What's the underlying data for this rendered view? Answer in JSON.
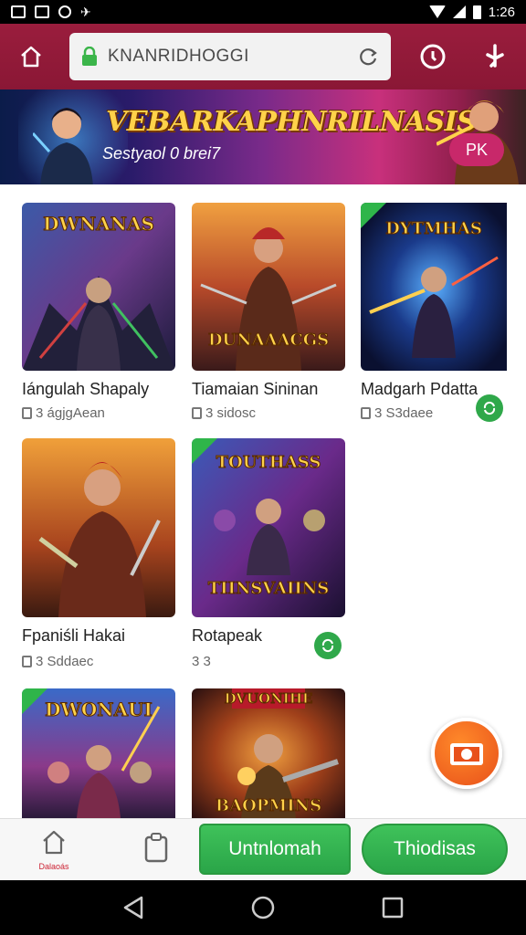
{
  "status_bar": {
    "time": "1:26",
    "icons": [
      "notification-icon",
      "shield-icon",
      "alarm-icon",
      "wifi-icon",
      "signal-icon",
      "battery-icon"
    ]
  },
  "browser": {
    "url": "KNANRIDHOGGI",
    "icons": [
      "home-icon",
      "lock-icon",
      "reload-icon",
      "tabs-icon",
      "menu-icon"
    ]
  },
  "banner": {
    "title": "VEBARKAPHNRILNASIS",
    "subtitle": "Sestyaol 0 brei7",
    "badge": "PK"
  },
  "games": [
    {
      "name": "Iángulah Shapaly",
      "meta": "3 ágjgAean",
      "logo": "DWNANAS",
      "corner": false,
      "badge": false
    },
    {
      "name": "Tiamaian Sininan",
      "meta": "3 sidosc",
      "logo": "DUNAAACGS",
      "corner": false,
      "badge": false
    },
    {
      "name": "Madgarh Pdatta",
      "meta": "3 S3daee",
      "logo": "DYTMHAS",
      "corner": true,
      "badge": true
    },
    {
      "name": "Fpaniśli Hakai",
      "meta": "3 Sddaec",
      "logo": "",
      "corner": false,
      "badge": false
    },
    {
      "name": "Rotapeak",
      "meta": "3 3",
      "logo": "TOUTHASS",
      "logo2": "TIINSVAIINS",
      "corner": true,
      "badge": true
    },
    {
      "name": "",
      "meta": "",
      "logo": "DWONAUI",
      "corner": true,
      "badge": false
    },
    {
      "name": "",
      "meta": "",
      "logo": "DVUONIHE",
      "logo2": "BAOPMINS",
      "corner": false,
      "badge": false
    }
  ],
  "bottom_bar": {
    "home_label": "Dalaoás",
    "button1": "Untnlomah",
    "button2": "Thiodisas"
  },
  "colors": {
    "toolbar": "#8a1735",
    "green": "#2fa84a",
    "fab": "#e8501a"
  }
}
